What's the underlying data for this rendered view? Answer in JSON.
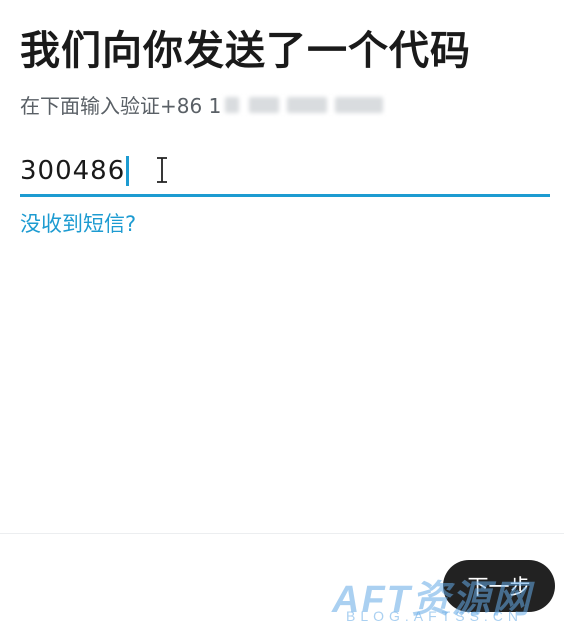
{
  "header": {
    "title": "我们向你发送了一个代码",
    "subtitle_prefix": "在下面输入验证+86 1"
  },
  "code_field": {
    "value": "300486"
  },
  "resend_link": "没收到短信?",
  "footer": {
    "next_label": "下一步"
  },
  "watermark": {
    "main": "AFT资源网",
    "sub": "BLOG.AFTSS.CN"
  },
  "colors": {
    "accent": "#1d9bd1",
    "button": "#222222",
    "title": "#1a1a1a"
  }
}
